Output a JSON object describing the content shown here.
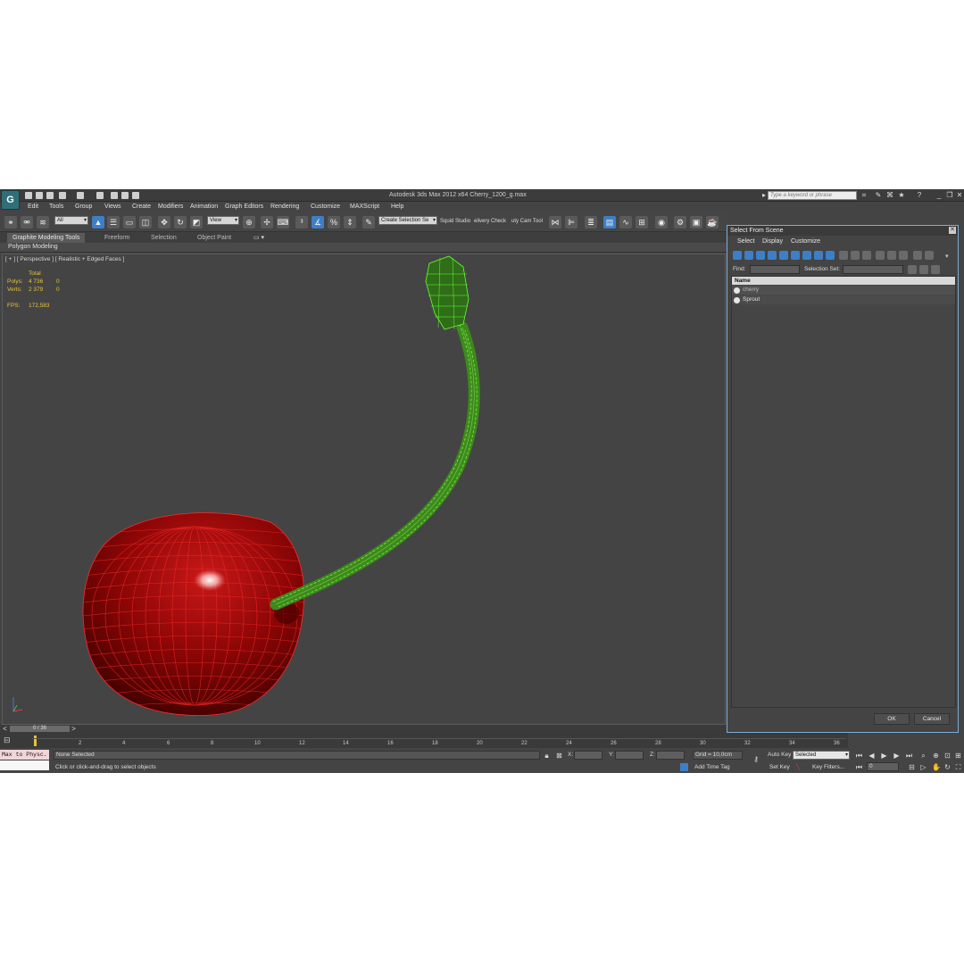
{
  "window": {
    "title": "Autodesk 3ds Max  2012 x64      Cherry_1200_g.max",
    "logo": "3ds-max-logo",
    "search_placeholder": "Type a keyword or phrase"
  },
  "menu": [
    "Edit",
    "Tools",
    "Group",
    "Views",
    "Create",
    "Modifiers",
    "Animation",
    "Graph Editors",
    "Rendering",
    "Customize",
    "MAXScript",
    "Help"
  ],
  "toolbar": {
    "filter_value": "All",
    "refcoord_value": "View",
    "selection_set": "Create Selection Se",
    "plugin1": "Squid Studio",
    "plugin2": "elivery Check",
    "plugin3": "uty Cam Tool"
  },
  "ribbon": {
    "tabs": [
      "Graphite Modeling Tools",
      "Freeform",
      "Selection",
      "Object Paint"
    ],
    "panel": "Polygon Modeling"
  },
  "viewport": {
    "label": "[ + ] [ Perspective ] [ Realistic + Edged Faces ]",
    "stats": {
      "header": "Total",
      "polys_label": "Polys:",
      "polys_value": "4 736",
      "polys_sel": "0",
      "verts_label": "Verts:",
      "verts_value": "2 379",
      "verts_sel": "0",
      "fps_label": "FPS:",
      "fps_value": "172,583"
    },
    "colors": {
      "cherry": "#8b0000",
      "stem": "#3d8a1c",
      "wire_red": "#ff2020",
      "wire_green": "#66ff33"
    }
  },
  "timeline": {
    "slider": "0 / 36",
    "ticks": [
      "2",
      "4",
      "6",
      "8",
      "10",
      "12",
      "14",
      "16",
      "18",
      "20",
      "22",
      "24",
      "26",
      "28",
      "30",
      "32",
      "34",
      "36"
    ]
  },
  "status": {
    "maxscript": "Max to Physc.",
    "selection": "None Selected",
    "prompt": "Click or click-and-drag to select objects",
    "x": "X:",
    "y": "Y:",
    "z": "Z:",
    "grid": "Grid = 10,0cm",
    "add_time_tag": "Add Time Tag",
    "auto_key": "Auto Key",
    "set_key": "Set Key",
    "key_mode": "Selected",
    "key_filters": "Key Filters...",
    "frame": "0"
  },
  "dialog": {
    "title": "Select From Scene",
    "menu": [
      "Select",
      "Display",
      "Customize"
    ],
    "find_label": "Find:",
    "selection_set_label": "Selection Set:",
    "column": "Name",
    "items": [
      "cherry",
      "Sprout"
    ],
    "ok": "OK",
    "cancel": "Cancel"
  }
}
